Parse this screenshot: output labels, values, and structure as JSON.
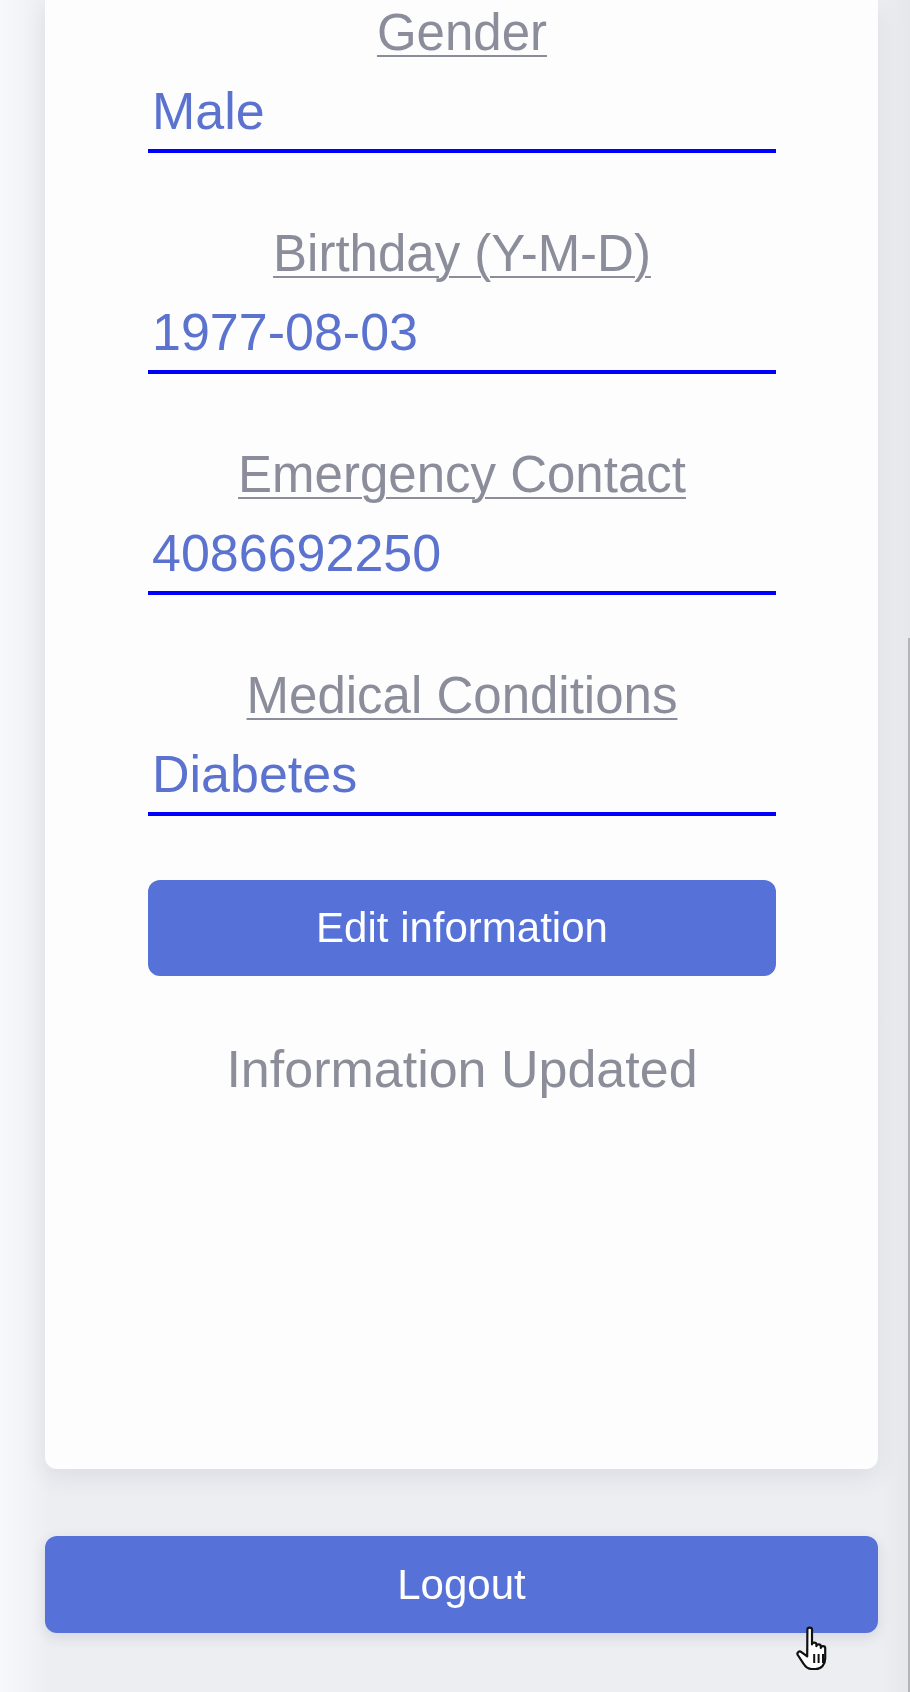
{
  "profile_form": {
    "fields": [
      {
        "label": "Gender",
        "value": "Male"
      },
      {
        "label": "Birthday (Y-M-D)",
        "value": "1977-08-03"
      },
      {
        "label": "Emergency Contact",
        "value": "4086692250"
      },
      {
        "label": "Medical Conditions",
        "value": "Diabetes"
      }
    ],
    "edit_button": "Edit information",
    "status_message": "Information Updated"
  },
  "logout_button": "Logout"
}
